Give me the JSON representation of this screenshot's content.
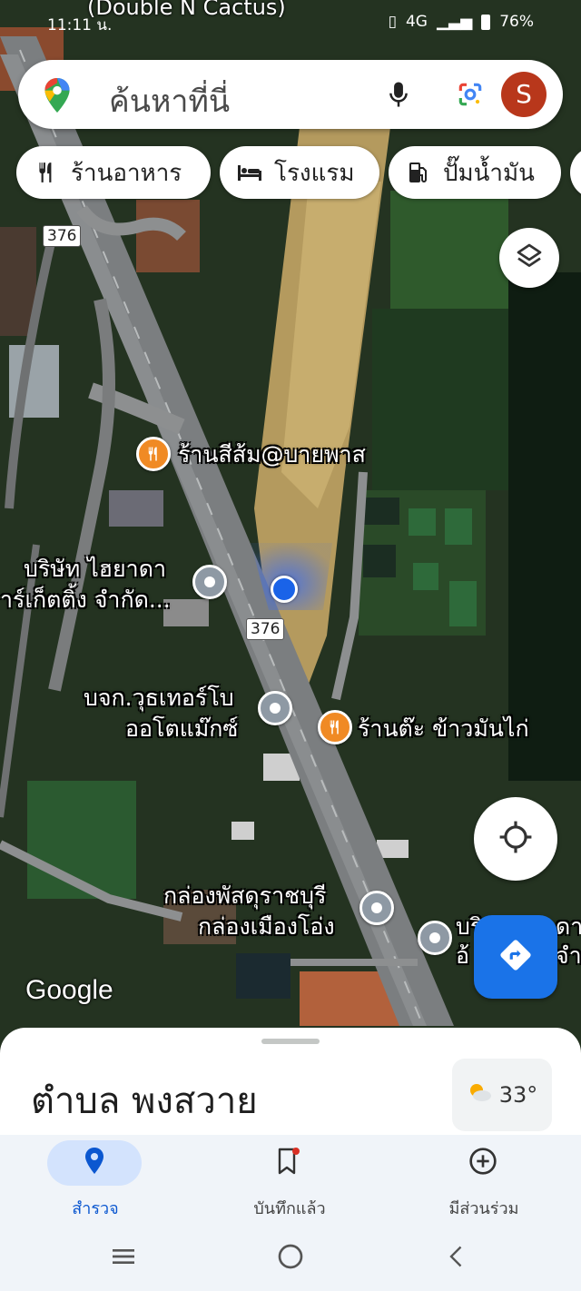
{
  "status_bar": {
    "time": "11:11 น.",
    "top_label": "(Double N Cactus)",
    "battery": "76%",
    "network": "4G"
  },
  "search": {
    "placeholder": "ค้นหาที่นี่",
    "avatar_letter": "S"
  },
  "chips": [
    {
      "label": "ร้านอาหาร",
      "icon": "fork-knife-icon"
    },
    {
      "label": "โรงแรม",
      "icon": "bed-icon"
    },
    {
      "label": "ปั๊มน้ำมัน",
      "icon": "gas-pump-icon"
    }
  ],
  "road_shields": [
    "376",
    "376"
  ],
  "pois": [
    {
      "name": "ร้านสีส้ม@บายพาส",
      "type": "restaurant"
    },
    {
      "name_line1": "บริษัท ไฮยาดา",
      "name_line2": "าร์เก็ตติ้ง จำกัด...",
      "type": "place"
    },
    {
      "name_line1": "บจก.วุธเทอร์โบ",
      "name_line2": "ออโตแม๊กซ์",
      "type": "place"
    },
    {
      "name": "ร้านต๊ะ ข้าวมันไก่",
      "type": "restaurant"
    },
    {
      "name_line1": "กล่องพัสดุราชบุรี",
      "name_line2": "กล่องเมืองโอ่ง",
      "type": "place"
    },
    {
      "name_line1": "บริ",
      "name_line2": "อ้",
      "name_right1": "ดา",
      "name_right2": "จำ",
      "type": "place"
    }
  ],
  "map_attribution": "Google",
  "sheet": {
    "title": "ตำบล พงสวาย",
    "weather_temp": "33°"
  },
  "nav": [
    {
      "label": "สำรวจ",
      "active": true
    },
    {
      "label": "บันทึกแล้ว",
      "active": false
    },
    {
      "label": "มีส่วนร่วม",
      "active": false
    }
  ],
  "colors": {
    "accent": "#1a73e8",
    "restaurant": "#f08a24",
    "poi": "#8e99a4",
    "avatar": "#b8371b"
  }
}
